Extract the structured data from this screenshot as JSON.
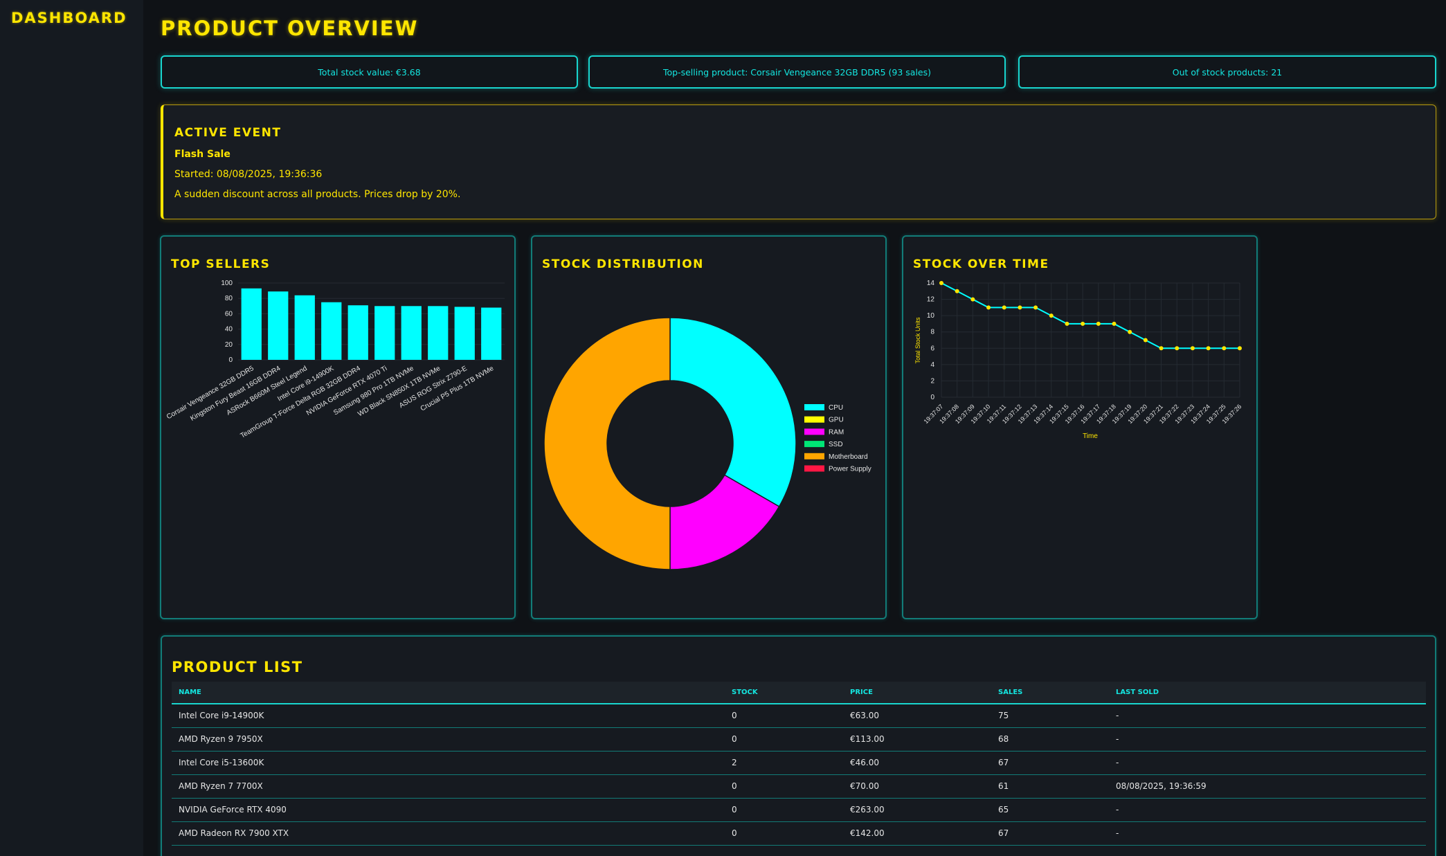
{
  "sidebar": {
    "title": "DASHBOARD"
  },
  "header": {
    "title": "PRODUCT OVERVIEW"
  },
  "stats": [
    {
      "text": "Total stock value: €3.68"
    },
    {
      "text": "Top-selling product: Corsair Vengeance 32GB DDR5 (93 sales)"
    },
    {
      "text": "Out of stock products: 21"
    }
  ],
  "event": {
    "heading": "ACTIVE EVENT",
    "name": "Flash Sale",
    "started": "Started: 08/08/2025, 19:36:36",
    "description": "A sudden discount across all products. Prices drop by 20%."
  },
  "panels": {
    "top_sellers": "TOP SELLERS",
    "stock_distribution": "STOCK DISTRIBUTION",
    "stock_over_time": "STOCK OVER TIME"
  },
  "colors": {
    "cyan": "#00ffff",
    "yellow": "#ffe600"
  },
  "chart_data": [
    {
      "type": "bar",
      "title": "TOP SELLERS",
      "categories": [
        "Corsair Vengeance 32GB DDR5",
        "Kingston Fury Beast 16GB DDR4",
        "ASRock B660M Steel Legend",
        "Intel Core i9-14900K",
        "TeamGroup T-Force Delta RGB 32GB DDR4",
        "NVIDIA GeForce RTX 4070 Ti",
        "Samsung 980 Pro 1TB NVMe",
        "WD Black SN850X 1TB NVMe",
        "ASUS ROG Strix Z790-E",
        "Crucial P5 Plus 1TB NVMe"
      ],
      "values": [
        93,
        89,
        84,
        75,
        71,
        70,
        70,
        70,
        69,
        68
      ],
      "ylim": [
        0,
        100
      ],
      "yticks": [
        0,
        20,
        40,
        60,
        80,
        100
      ],
      "color": "#00ffff"
    },
    {
      "type": "pie",
      "title": "STOCK DISTRIBUTION",
      "labels": [
        "CPU",
        "GPU",
        "RAM",
        "SSD",
        "Motherboard",
        "Power Supply"
      ],
      "values": [
        6,
        0,
        3,
        0,
        9,
        0
      ],
      "colors": [
        "#00ffff",
        "#ffff00",
        "#ff00ff",
        "#00e676",
        "#ffa500",
        "#ff1744"
      ],
      "legend_position": "right"
    },
    {
      "type": "line",
      "title": "STOCK OVER TIME",
      "xlabel": "Time",
      "ylabel": "Total Stock Units",
      "x": [
        "19:37:07",
        "19:37:08",
        "19:37:09",
        "19:37:10",
        "19:37:11",
        "19:37:12",
        "19:37:13",
        "19:37:14",
        "19:37:15",
        "19:37:16",
        "19:37:17",
        "19:37:18",
        "19:37:19",
        "19:37:20",
        "19:37:21",
        "19:37:22",
        "19:37:23",
        "19:37:24",
        "19:37:25",
        "19:37:26"
      ],
      "values": [
        14,
        13,
        12,
        11,
        11,
        11,
        11,
        10,
        9,
        9,
        9,
        9,
        8,
        7,
        6,
        6,
        6,
        6,
        6,
        6
      ],
      "ylim": [
        0,
        14
      ],
      "yticks": [
        0,
        2,
        4,
        6,
        8,
        10,
        12,
        14
      ],
      "grid": true,
      "color": "#00ffff",
      "point_color": "#ffe600"
    }
  ],
  "product_list": {
    "title": "PRODUCT LIST",
    "columns": [
      "NAME",
      "STOCK",
      "PRICE",
      "SALES",
      "LAST SOLD"
    ],
    "rows": [
      [
        "Intel Core i9-14900K",
        "0",
        "€63.00",
        "75",
        "-"
      ],
      [
        "AMD Ryzen 9 7950X",
        "0",
        "€113.00",
        "68",
        "-"
      ],
      [
        "Intel Core i5-13600K",
        "2",
        "€46.00",
        "67",
        "-"
      ],
      [
        "AMD Ryzen 7 7700X",
        "0",
        "€70.00",
        "61",
        "08/08/2025, 19:36:59"
      ],
      [
        "NVIDIA GeForce RTX 4090",
        "0",
        "€263.00",
        "65",
        "-"
      ],
      [
        "AMD Radeon RX 7900 XTX",
        "0",
        "€142.00",
        "67",
        "-"
      ]
    ]
  }
}
